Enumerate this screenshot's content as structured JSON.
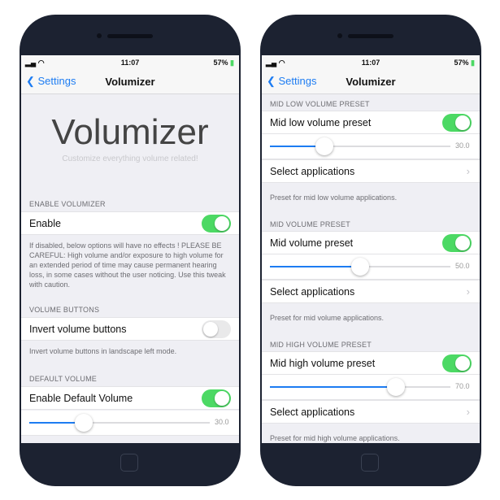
{
  "status": {
    "time": "11:07",
    "battery": "57%",
    "signal_icon": "signal-icon",
    "wifi_icon": "wifi-icon"
  },
  "nav": {
    "back_label": "Settings",
    "title": "Volumizer"
  },
  "left": {
    "app_title": "Volumizer",
    "app_subtitle": "Customize everything volume related!",
    "enable_header": "ENABLE VOLUMIZER",
    "enable_label": "Enable",
    "enable_on": true,
    "enable_footer": "If disabled, below options will have no effects ! PLEASE BE CAREFUL: High volume and/or exposure to high volume for an extended period of time may cause permanent hearing loss, in some cases without the user noticing. Use this tweak with caution.",
    "buttons_header": "VOLUME BUTTONS",
    "invert_label": "Invert volume buttons",
    "invert_on": false,
    "invert_footer": "Invert volume buttons in landscape left mode.",
    "default_header": "DEFAULT VOLUME",
    "default_label": "Enable Default Volume",
    "default_on": true,
    "default_value": 30,
    "default_value_text": "30.0"
  },
  "right": {
    "sections": [
      {
        "header": "MID LOW VOLUME PRESET",
        "label": "Mid low volume preset",
        "on": true,
        "value": 30,
        "value_text": "30.0",
        "select": "Select applications",
        "footer": "Preset for mid low volume applications."
      },
      {
        "header": "MID VOLUME PRESET",
        "label": "Mid volume preset",
        "on": true,
        "value": 50,
        "value_text": "50.0",
        "select": "Select applications",
        "footer": "Preset for mid volume applications."
      },
      {
        "header": "MID HIGH VOLUME PRESET",
        "label": "Mid high volume preset",
        "on": true,
        "value": 70,
        "value_text": "70.0",
        "select": "Select applications",
        "footer": "Preset for mid high volume applications."
      }
    ]
  },
  "colors": {
    "accent": "#1d7cf2",
    "toggle_on": "#4cd964",
    "bezel": "#1c2231"
  }
}
